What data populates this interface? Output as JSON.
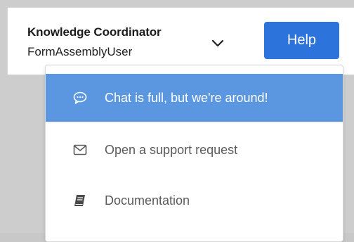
{
  "header": {
    "user_role": "Knowledge Coordinator",
    "user_name": "FormAssemblyUser",
    "user_menu_icon": "chevron-down-icon",
    "help_label": "Help"
  },
  "help_menu": {
    "items": [
      {
        "label": "Chat is full, but we're around!",
        "icon": "chat-bubble-icon",
        "active": true
      },
      {
        "label": "Open a support request",
        "icon": "envelope-icon",
        "active": false
      },
      {
        "label": "Documentation",
        "icon": "book-icon",
        "active": false
      }
    ]
  },
  "colors": {
    "accent": "#2d73dc",
    "active_item": "#5b97e0",
    "menu_text": "#5a5a5a",
    "background": "#cdcdcd"
  }
}
